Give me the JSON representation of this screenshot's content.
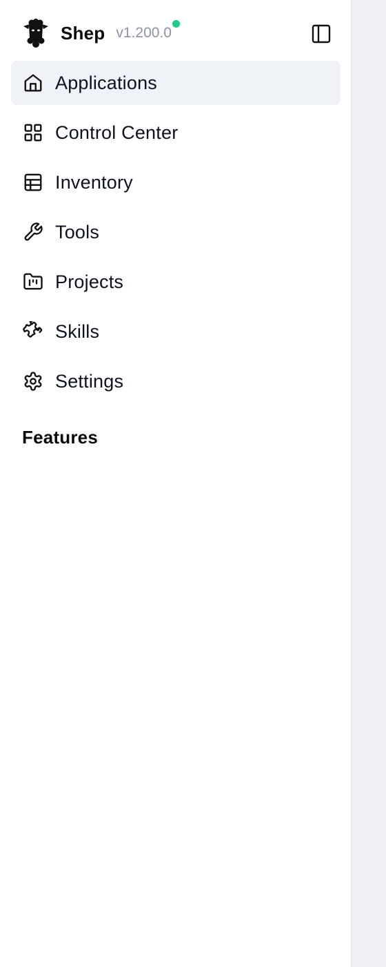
{
  "header": {
    "app_name": "Shep",
    "version": "v1.200.0",
    "status_color": "#22c98a",
    "toggle_icon": "sidebar-toggle-icon",
    "logo_icon": "sheep-logo-icon"
  },
  "nav": {
    "items": [
      {
        "label": "Applications",
        "icon": "home-icon",
        "active": true
      },
      {
        "label": "Control Center",
        "icon": "grid-icon",
        "active": false
      },
      {
        "label": "Inventory",
        "icon": "table-icon",
        "active": false
      },
      {
        "label": "Tools",
        "icon": "wrench-icon",
        "active": false
      },
      {
        "label": "Projects",
        "icon": "folder-kanban-icon",
        "active": false
      },
      {
        "label": "Skills",
        "icon": "puzzle-icon",
        "active": false
      },
      {
        "label": "Settings",
        "icon": "gear-icon",
        "active": false
      }
    ]
  },
  "sections": {
    "features_title": "Features"
  },
  "colors": {
    "active_bg": "#eff2f7",
    "main_bg": "#eef0f5",
    "muted_text": "#8a94a6"
  }
}
